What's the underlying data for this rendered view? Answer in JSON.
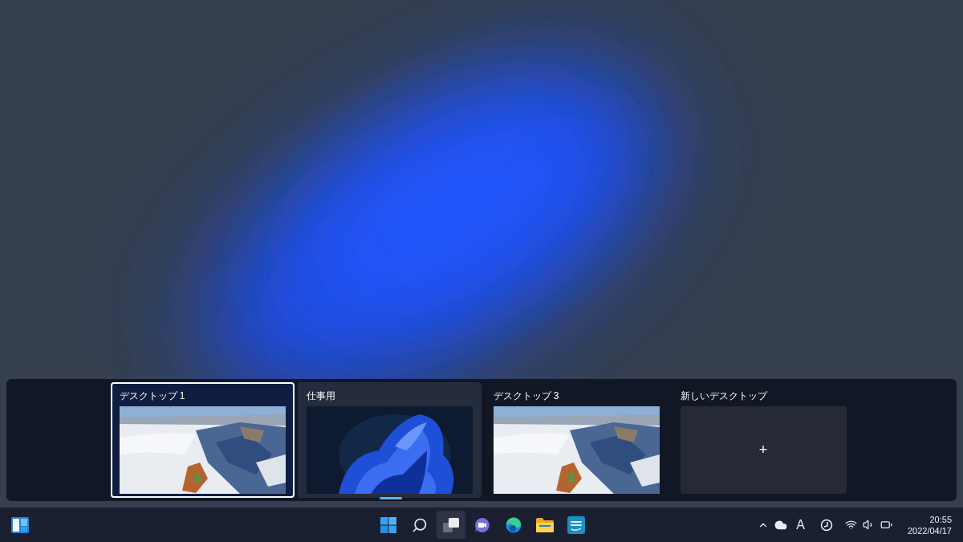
{
  "task_view": {
    "desktops": [
      {
        "label": "デスクトップ 1",
        "selected": true,
        "hovered": false
      },
      {
        "label": "仕事用",
        "selected": false,
        "hovered": true
      },
      {
        "label": "デスクトップ 3",
        "selected": false,
        "hovered": false
      }
    ],
    "new_desktop": {
      "label": "新しいデスクトップ",
      "button": "+"
    }
  },
  "taskbar": {
    "apps": [
      {
        "kind": "start",
        "active": false
      },
      {
        "kind": "search",
        "active": false
      },
      {
        "kind": "taskview",
        "active": true
      },
      {
        "kind": "chat",
        "active": false
      },
      {
        "kind": "browser",
        "active": false
      },
      {
        "kind": "folder",
        "active": false
      },
      {
        "kind": "video",
        "active": false
      }
    ],
    "tray": {
      "ime": "A",
      "time": "20:55",
      "date": "2022/04/17"
    }
  }
}
